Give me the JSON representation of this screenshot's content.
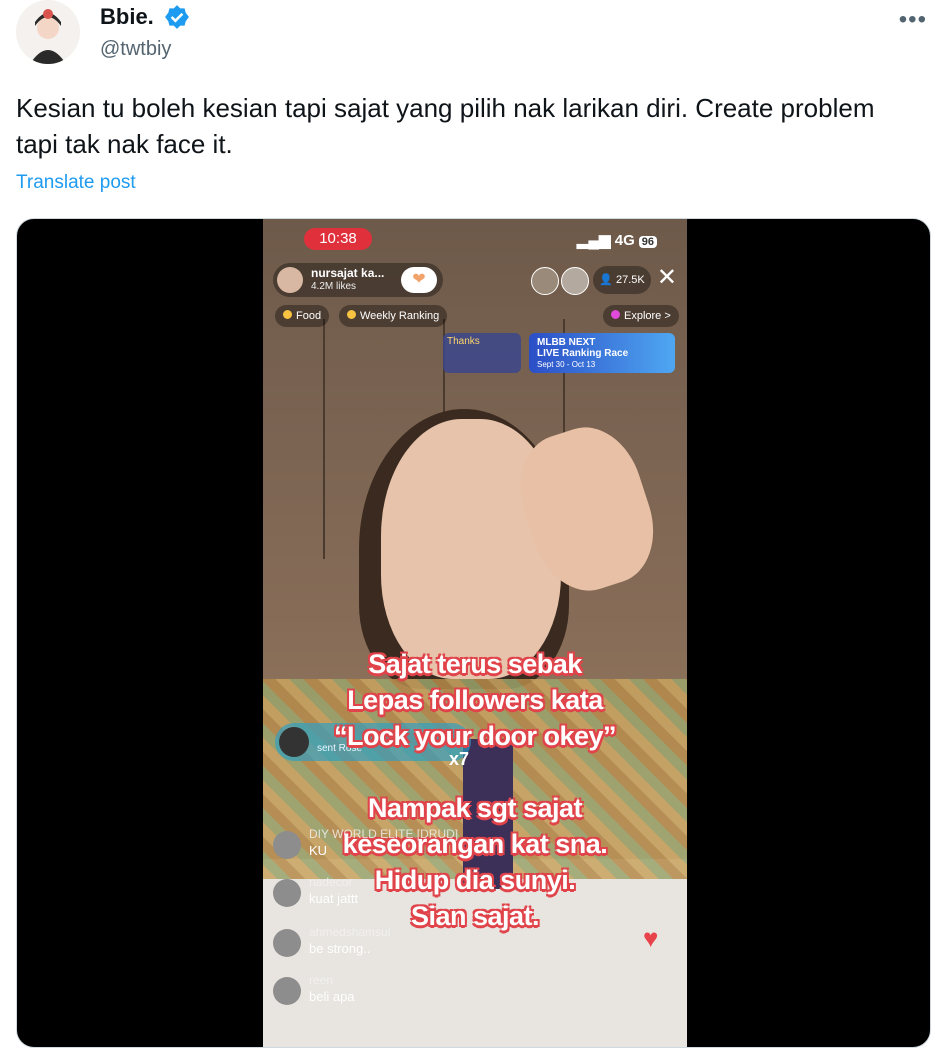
{
  "tweet": {
    "author_name": "Bbie.",
    "author_handle": "@twtbiy",
    "more_icon": "•••",
    "text": "Kesian tu boleh kesian tapi sajat yang pilih nak larikan diri. Create problem tapi tak nak face it.",
    "translate_label": "Translate post"
  },
  "live": {
    "time": "10:38",
    "network": "4G",
    "battery": "96",
    "host_name": "nursajat ka...",
    "host_likes": "4.2M likes",
    "viewer_count": "27.5K",
    "close_icon": "✕",
    "chips": [
      "Food",
      "Weekly Ranking",
      "Explore >"
    ],
    "thanks_label": "Thanks",
    "event_line1": "MLBB NEXT",
    "event_line2": "LIVE Ranking Race",
    "event_dates": "Sept 30 - Oct 13",
    "gift_text": "sent Rose",
    "gift_count": "x7",
    "comments": [
      {
        "user": "DIY WORLD ELITE [DRUD]",
        "text": "KU"
      },
      {
        "user": "nadecor",
        "text": "kuat jattt"
      },
      {
        "user": "ahmedshamsul",
        "text": "be strong.."
      },
      {
        "user": "reen",
        "text": "beli apa"
      }
    ],
    "caption_lines": [
      "Sajat terus sebak",
      "Lepas followers kata",
      "“Lock your door okey”",
      "Nampak sgt sajat",
      "keseorangan kat sna.",
      "Hidup dia sunyi.",
      "Sian sajat."
    ],
    "heart_icon": "♥"
  }
}
